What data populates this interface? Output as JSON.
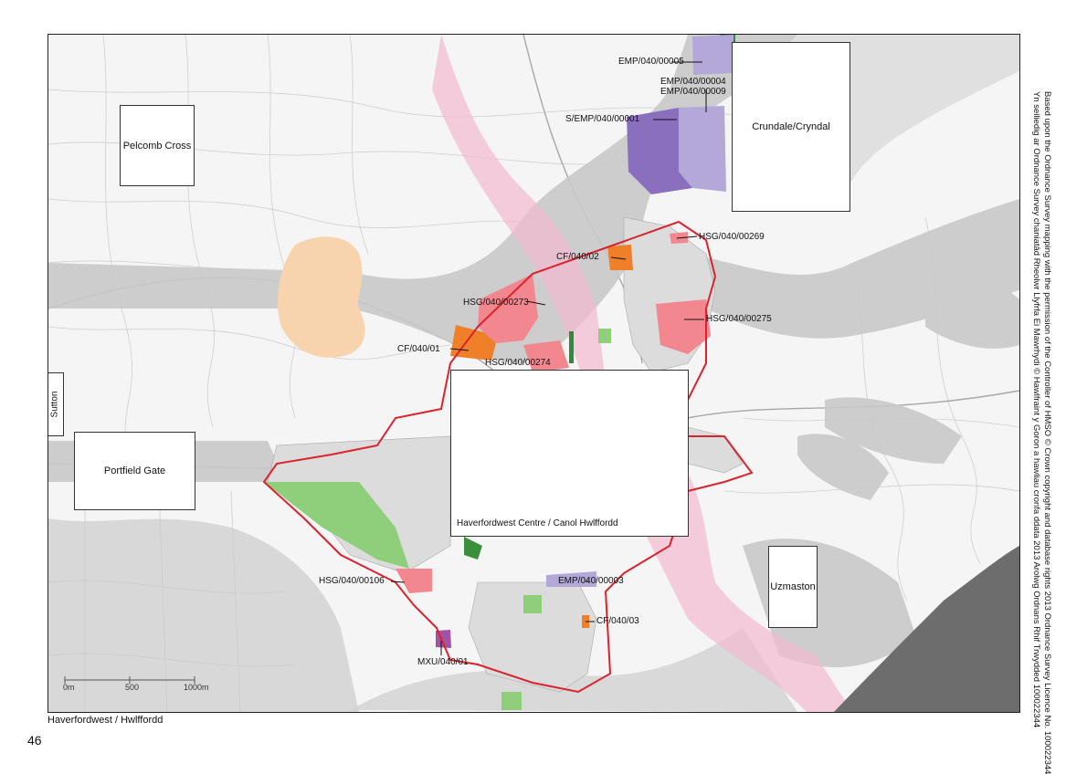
{
  "map": {
    "caption": "Haverfordwest / Hwlffordd",
    "page_number": "46",
    "copyright_lines": [
      "Based upon the Ordnance Survey mapping with the permission of the Controller of HMSO © Crown copyright and database rights 2013 Ordnance Survey Licence No. 100022344",
      "Yn seiliedig ar Ordnance Survey chaniatâd Rheolwr Llyfrfa Ei Mawrhydi © Hawlfraint y Goron a hawliau cronfa ddata 2013 Arolwg Ordnans Rhif Trwydded 100022344"
    ],
    "inset_labels": {
      "pelcomb": "Pelcomb Cross",
      "crundale": "Crundale/Cryndal",
      "sutton": "Sutton",
      "portfield": "Portfield Gate",
      "centre": "Haverfordwest Centre / Canol Hwlffordd",
      "uzmaston": "Uzmaston"
    },
    "scale": {
      "labels": [
        "0m",
        "500",
        "1000m"
      ]
    },
    "site_labels": {
      "emp_00005": "EMP/040/00005",
      "emp_00004": "EMP/040/00004",
      "emp_00009": "EMP/040/00009",
      "s_emp_00001": "S/EMP/040/00001",
      "hsg_00269": "HSG/040/00269",
      "cf_02": "CF/040/02",
      "hsg_00273": "HSG/040/00273",
      "hsg_00275": "HSG/040/00275",
      "cf_01": "CF/040/01",
      "hsg_00274": "HSG/040/00274",
      "hsg_00106": "HSG/040/00106",
      "emp_00003": "EMP/040/00003",
      "cf_03": "CF/040/03",
      "mxu_01": "MXU/040/01"
    },
    "colors": {
      "housing": "#f2878f",
      "community": "#f07f2a",
      "employment": "#b3a8d8",
      "strategic_employment": "#8a6fbf",
      "mixed_use": "#a353a5",
      "green_space": "#8fcf7c",
      "boundary": "#d9232e",
      "flood_zone": "#c9c9c9",
      "river_corridor": "#f4b9cf",
      "sensitive_area": "#f8d4ae",
      "dark_area": "#6d6d6d"
    }
  }
}
